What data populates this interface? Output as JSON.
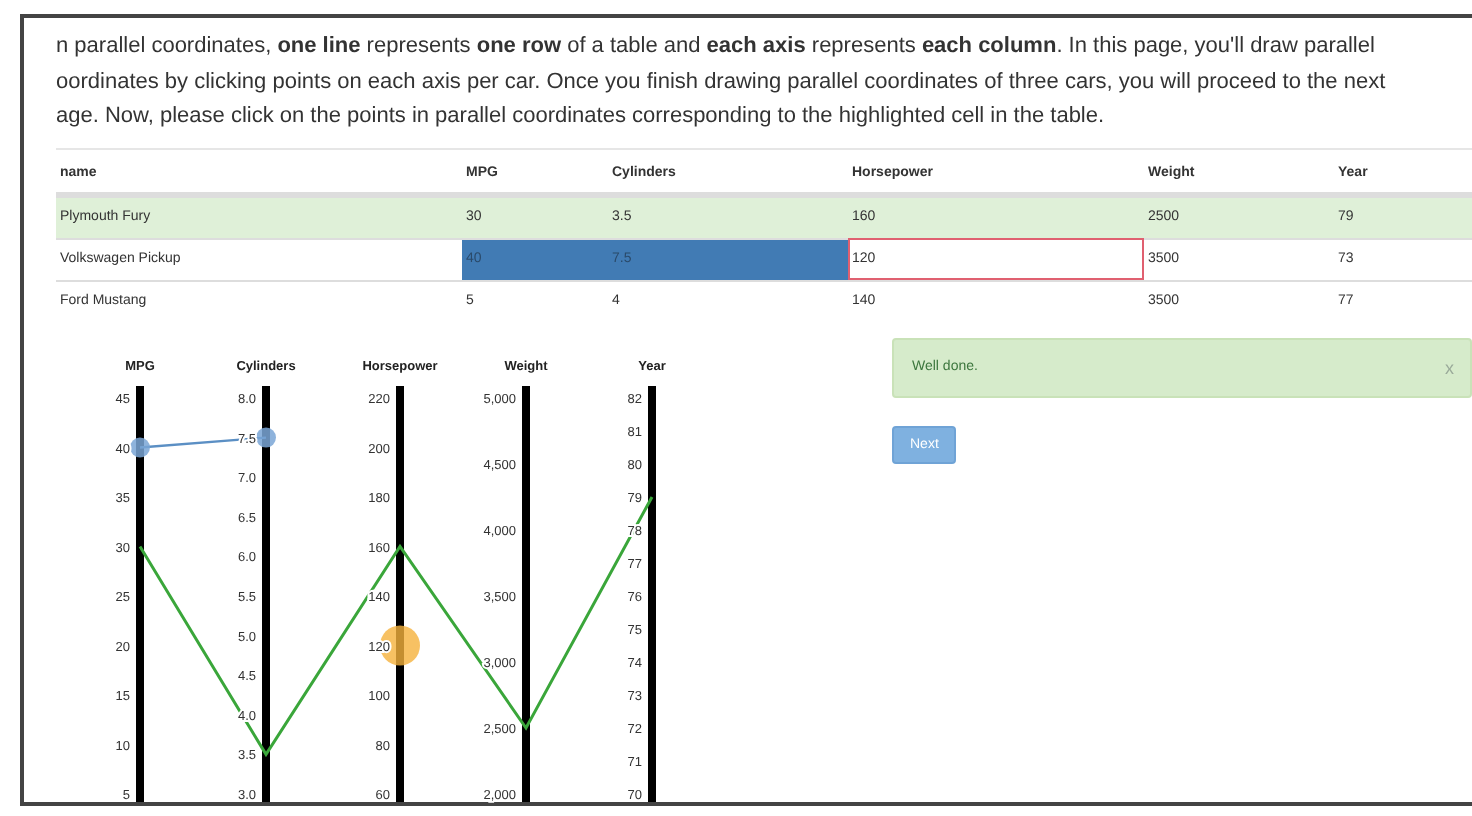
{
  "instructions": [
    "n parallel coordinates, **one line** represents **one row** of a table and **each axis** represents **each column**. In this page, you'll draw parallel",
    "oordinates by clicking points on each axis per car. Once you finish drawing parallel coordinates of three cars, you will proceed to the next",
    "age. Now, please click on the points in parallel coordinates corresponding to the highlighted cell in the table."
  ],
  "table": {
    "columns": [
      "name",
      "MPG",
      "Cylinders",
      "Horsepower",
      "Weight",
      "Year"
    ],
    "rows": [
      {
        "selected": true,
        "cells": [
          {
            "text": "Plymouth Fury",
            "picked": false,
            "highlighted": false
          },
          {
            "text": "30",
            "picked": false,
            "highlighted": false
          },
          {
            "text": "3.5",
            "picked": false,
            "highlighted": false
          },
          {
            "text": "160",
            "picked": false,
            "highlighted": false
          },
          {
            "text": "2500",
            "picked": false,
            "highlighted": false
          },
          {
            "text": "79",
            "picked": false,
            "highlighted": false
          }
        ]
      },
      {
        "selected": false,
        "cells": [
          {
            "text": "Volkswagen Pickup",
            "picked": false,
            "highlighted": false
          },
          {
            "text": "40",
            "picked": true,
            "highlighted": false
          },
          {
            "text": "7.5",
            "picked": true,
            "highlighted": false
          },
          {
            "text": "120",
            "picked": false,
            "highlighted": true
          },
          {
            "text": "3500",
            "picked": false,
            "highlighted": false
          },
          {
            "text": "73",
            "picked": false,
            "highlighted": false
          }
        ]
      },
      {
        "selected": false,
        "cells": [
          {
            "text": "Ford Mustang",
            "picked": false,
            "highlighted": false
          },
          {
            "text": "5",
            "picked": false,
            "highlighted": false
          },
          {
            "text": "4",
            "picked": false,
            "highlighted": false
          },
          {
            "text": "140",
            "picked": false,
            "highlighted": false
          },
          {
            "text": "3500",
            "picked": false,
            "highlighted": false
          },
          {
            "text": "77",
            "picked": false,
            "highlighted": false
          }
        ]
      }
    ]
  },
  "parallel_coordinates": {
    "axes": [
      {
        "label": "MPG",
        "ticks": [
          "45",
          "40",
          "35",
          "30",
          "25",
          "20",
          "15",
          "10",
          "5"
        ]
      },
      {
        "label": "Cylinders",
        "ticks": [
          "8.0",
          "7.5",
          "7.0",
          "6.5",
          "6.0",
          "5.5",
          "5.0",
          "4.5",
          "4.0",
          "3.5",
          "3.0"
        ]
      },
      {
        "label": "Horsepower",
        "ticks": [
          "220",
          "200",
          "180",
          "160",
          "140",
          "120",
          "100",
          "80",
          "60"
        ]
      },
      {
        "label": "Weight",
        "ticks": [
          "5,000",
          "4,500",
          "4,000",
          "3,500",
          "3,000",
          "2,500",
          "2,000"
        ]
      },
      {
        "label": "Year",
        "ticks": [
          "82",
          "81",
          "80",
          "79",
          "78",
          "77",
          "76",
          "75",
          "74",
          "73",
          "72",
          "71",
          "70"
        ]
      }
    ]
  },
  "alert": {
    "message": "Well done.",
    "close": "x"
  },
  "next_button": "Next"
}
